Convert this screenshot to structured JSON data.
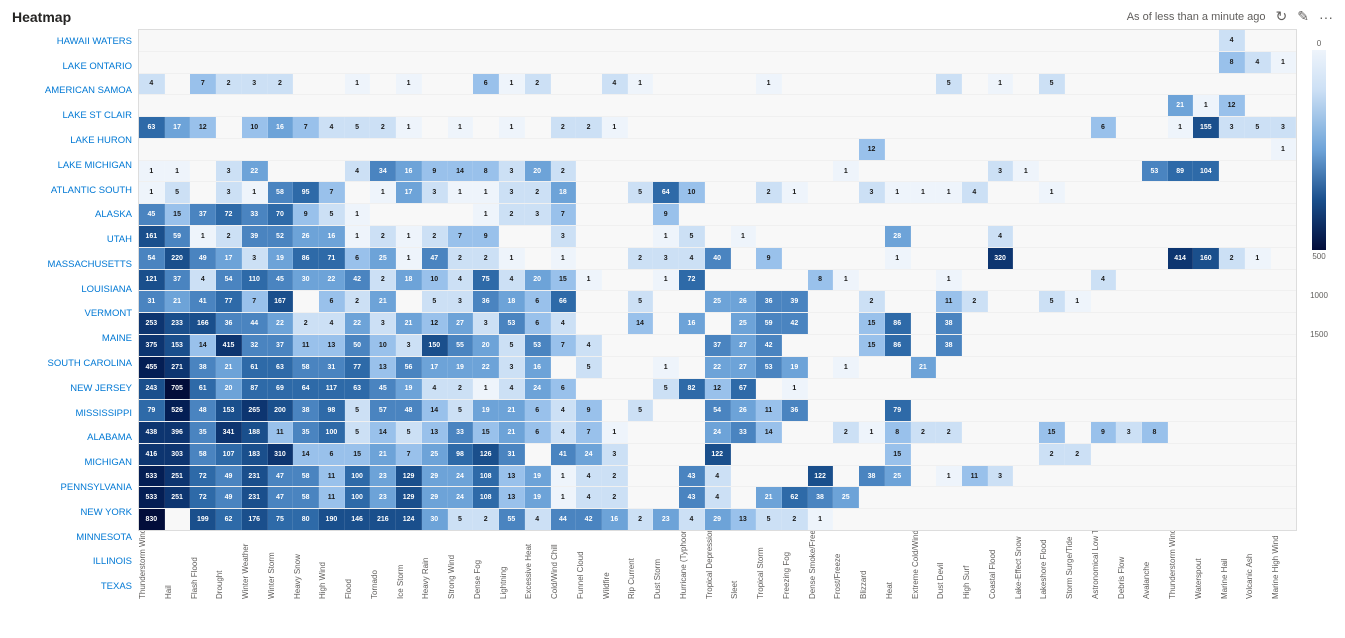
{
  "header": {
    "title": "Heatmap",
    "timestamp": "As of less than a minute ago",
    "refresh_icon": "↻",
    "edit_icon": "✎",
    "more_icon": "···"
  },
  "legend": {
    "values": [
      "0",
      "",
      "500",
      "",
      "1000",
      "",
      "1500"
    ]
  },
  "y_labels": [
    "HAWAII WATERS",
    "LAKE ONTARIO",
    "AMERICAN SAMOA",
    "LAKE ST CLAIR",
    "LAKE HURON",
    "LAKE MICHIGAN",
    "ATLANTIC SOUTH",
    "ALASKA",
    "UTAH",
    "MASSACHUSETTS",
    "LOUISIANA",
    "VERMONT",
    "MAINE",
    "SOUTH CAROLINA",
    "NEW JERSEY",
    "MISSISSIPPI",
    "ALABAMA",
    "MICHIGAN",
    "PENNSYLVANIA",
    "NEW YORK",
    "MINNESOTA",
    "ILLINOIS",
    "TEXAS"
  ],
  "x_labels": [
    "Thunderstorm Wind",
    "Hail",
    "Flash Flood",
    "Drought",
    "Winter Weather",
    "Winter Storm",
    "Heavy Snow",
    "High Wind",
    "Flood",
    "Tornado",
    "Ice Storm",
    "Heavy Rain",
    "Strong Wind",
    "Dense Fog",
    "Lightning",
    "Excessive Heat",
    "Cold/Wind Chill",
    "Funnel Cloud",
    "Wildfire",
    "Rip Current",
    "Dust Storm",
    "Hurricane (Typhoon)",
    "Tropical Depression",
    "Sleet",
    "Tropical Storm",
    "Freezing Fog",
    "Dense Smoke/Freeze",
    "Frost/Freeze",
    "Blizzard",
    "Heat",
    "Extreme Cold/Wind Chill",
    "Dust Devil",
    "High Surf",
    "Coastal Flood",
    "Lake-Effect Snow",
    "Lakeshore Flood",
    "Storm Surge/Tide",
    "Astronomical Low Tide",
    "Debris Flow",
    "Avalanche",
    "Thunderstorm Wind",
    "Waterspout",
    "Marine Hail",
    "Volcanic Ash",
    "Marine High Wind"
  ],
  "rows": [
    {
      "label": "HAWAII WATERS",
      "cells": [
        0,
        0,
        0,
        0,
        0,
        0,
        0,
        0,
        0,
        0,
        0,
        0,
        0,
        0,
        0,
        0,
        0,
        0,
        0,
        0,
        0,
        0,
        0,
        0,
        0,
        0,
        0,
        0,
        0,
        0,
        0,
        0,
        0,
        0,
        0,
        0,
        0,
        0,
        0,
        0,
        0,
        0,
        4,
        0,
        0
      ]
    },
    {
      "label": "LAKE ONTARIO",
      "cells": [
        0,
        0,
        0,
        0,
        0,
        0,
        0,
        0,
        0,
        0,
        0,
        0,
        0,
        0,
        0,
        0,
        0,
        0,
        0,
        0,
        0,
        0,
        0,
        0,
        0,
        0,
        0,
        0,
        0,
        0,
        0,
        0,
        0,
        0,
        0,
        0,
        0,
        0,
        0,
        0,
        0,
        0,
        8,
        4,
        1
      ]
    },
    {
      "label": "AMERICAN SAMOA",
      "cells": [
        4,
        0,
        7,
        2,
        3,
        2,
        0,
        0,
        1,
        0,
        1,
        0,
        0,
        6,
        1,
        2,
        0,
        0,
        4,
        1,
        0,
        0,
        0,
        0,
        1,
        0,
        0,
        0,
        0,
        0,
        0,
        5,
        0,
        1,
        0,
        5,
        0,
        0,
        0,
        0,
        0,
        0,
        0,
        0,
        0
      ]
    },
    {
      "label": "LAKE ST CLAIR",
      "cells": [
        0,
        0,
        0,
        0,
        0,
        0,
        0,
        0,
        0,
        0,
        0,
        0,
        0,
        0,
        0,
        0,
        0,
        0,
        0,
        0,
        0,
        0,
        0,
        0,
        0,
        0,
        0,
        0,
        0,
        0,
        0,
        0,
        0,
        0,
        0,
        0,
        0,
        0,
        0,
        0,
        21,
        1,
        12,
        0,
        0
      ]
    },
    {
      "label": "LAKE HURON",
      "cells": [
        63,
        17,
        12,
        0,
        10,
        16,
        7,
        4,
        5,
        2,
        1,
        0,
        1,
        0,
        1,
        0,
        2,
        2,
        1,
        0,
        0,
        0,
        0,
        0,
        0,
        0,
        0,
        0,
        0,
        0,
        0,
        0,
        0,
        0,
        0,
        0,
        0,
        6,
        0,
        0,
        1,
        155,
        3,
        5,
        3
      ]
    },
    {
      "label": "LAKE MICHIGAN",
      "cells": [
        0,
        0,
        0,
        0,
        0,
        0,
        0,
        0,
        0,
        0,
        0,
        0,
        0,
        0,
        0,
        0,
        0,
        0,
        0,
        0,
        0,
        0,
        0,
        0,
        0,
        0,
        0,
        0,
        12,
        0,
        0,
        0,
        0,
        0,
        0,
        0,
        0,
        0,
        0,
        0,
        0,
        0,
        0,
        0,
        1
      ]
    },
    {
      "label": "ATLANTIC SOUTH",
      "cells": [
        1,
        1,
        0,
        3,
        22,
        0,
        0,
        0,
        4,
        34,
        16,
        9,
        14,
        8,
        3,
        20,
        2,
        0,
        0,
        0,
        0,
        0,
        0,
        0,
        0,
        0,
        0,
        1,
        0,
        0,
        0,
        0,
        0,
        3,
        1,
        0,
        0,
        0,
        0,
        53,
        89,
        104,
        0,
        0,
        0
      ]
    },
    {
      "label": "ALASKA",
      "cells": [
        1,
        5,
        0,
        3,
        1,
        58,
        95,
        7,
        0,
        1,
        17,
        3,
        1,
        1,
        3,
        2,
        18,
        0,
        0,
        5,
        64,
        10,
        0,
        0,
        2,
        1,
        0,
        0,
        3,
        1,
        1,
        1,
        4,
        0,
        0,
        1,
        0,
        0,
        0,
        0,
        0,
        0,
        0,
        0,
        0
      ]
    },
    {
      "label": "UTAH",
      "cells": [
        45,
        15,
        37,
        72,
        33,
        70,
        9,
        5,
        1,
        0,
        0,
        0,
        0,
        1,
        2,
        3,
        7,
        0,
        0,
        0,
        9,
        0,
        0,
        0,
        0,
        0,
        0,
        0,
        0,
        0,
        0,
        0,
        0,
        0,
        0,
        0,
        0,
        0,
        0,
        0,
        0,
        0,
        0,
        0,
        0
      ]
    },
    {
      "label": "MASSACHUSETTS",
      "cells": [
        161,
        59,
        1,
        2,
        39,
        52,
        26,
        16,
        1,
        2,
        1,
        2,
        7,
        9,
        0,
        0,
        3,
        0,
        0,
        0,
        1,
        5,
        0,
        1,
        0,
        0,
        0,
        0,
        0,
        28,
        0,
        0,
        0,
        4,
        0,
        0,
        0,
        0,
        0,
        0,
        0,
        0,
        0,
        0,
        0
      ]
    },
    {
      "label": "LOUISIANA",
      "cells": [
        54,
        220,
        49,
        17,
        3,
        19,
        86,
        71,
        6,
        25,
        1,
        47,
        2,
        2,
        1,
        0,
        1,
        0,
        0,
        2,
        3,
        4,
        40,
        0,
        9,
        0,
        0,
        0,
        0,
        1,
        0,
        0,
        0,
        320,
        0,
        0,
        0,
        0,
        0,
        0,
        414,
        160,
        2,
        1,
        0
      ]
    },
    {
      "label": "VERMONT",
      "cells": [
        121,
        37,
        4,
        54,
        110,
        45,
        30,
        22,
        42,
        2,
        18,
        10,
        4,
        75,
        4,
        20,
        15,
        1,
        0,
        0,
        1,
        72,
        0,
        0,
        0,
        0,
        8,
        1,
        0,
        0,
        0,
        1,
        0,
        0,
        0,
        0,
        0,
        4,
        0,
        0,
        0,
        0,
        0,
        0,
        0
      ]
    },
    {
      "label": "MAINE",
      "cells": [
        31,
        21,
        41,
        77,
        7,
        167,
        0,
        6,
        2,
        21,
        0,
        5,
        3,
        36,
        18,
        6,
        66,
        0,
        0,
        5,
        0,
        0,
        25,
        26,
        36,
        39,
        0,
        0,
        2,
        0,
        0,
        11,
        2,
        0,
        0,
        5,
        1,
        0,
        0,
        0,
        0,
        0,
        0,
        0,
        0
      ]
    },
    {
      "label": "SOUTH CAROLINA",
      "cells": [
        253,
        233,
        166,
        36,
        44,
        22,
        2,
        4,
        22,
        3,
        21,
        12,
        27,
        3,
        53,
        6,
        4,
        0,
        0,
        14,
        0,
        16,
        0,
        25,
        59,
        42,
        0,
        0,
        15,
        86,
        0,
        38,
        0,
        0,
        0,
        0,
        0,
        0,
        0,
        0,
        0,
        0,
        0,
        0,
        0
      ]
    },
    {
      "label": "NEW JERSEY",
      "cells": [
        375,
        153,
        14,
        415,
        32,
        37,
        11,
        13,
        50,
        10,
        3,
        150,
        55,
        20,
        5,
        53,
        7,
        4,
        0,
        0,
        0,
        0,
        37,
        27,
        42,
        0,
        0,
        0,
        15,
        86,
        0,
        38,
        0,
        0,
        0,
        0,
        0,
        0,
        0,
        0,
        0,
        0,
        0,
        0,
        0
      ]
    },
    {
      "label": "MISSISSIPPI",
      "cells": [
        455,
        271,
        38,
        21,
        61,
        63,
        58,
        31,
        77,
        13,
        56,
        17,
        19,
        22,
        3,
        16,
        0,
        5,
        0,
        0,
        1,
        0,
        22,
        27,
        53,
        19,
        0,
        1,
        0,
        0,
        21,
        0,
        0,
        0,
        0,
        0,
        0,
        0,
        0,
        0,
        0,
        0,
        0,
        0,
        0
      ]
    },
    {
      "label": "ALABAMA",
      "cells": [
        243,
        705,
        61,
        20,
        87,
        69,
        64,
        117,
        63,
        45,
        19,
        4,
        2,
        1,
        4,
        24,
        6,
        0,
        0,
        0,
        5,
        82,
        12,
        67,
        0,
        1,
        0,
        0,
        0,
        0,
        0,
        0,
        0,
        0,
        0,
        0,
        0,
        0,
        0,
        0,
        0,
        0,
        0,
        0,
        0
      ]
    },
    {
      "label": "MICHIGAN",
      "cells": [
        79,
        526,
        48,
        153,
        265,
        200,
        38,
        98,
        5,
        57,
        48,
        14,
        5,
        19,
        21,
        6,
        4,
        9,
        0,
        5,
        0,
        0,
        54,
        26,
        11,
        36,
        0,
        0,
        0,
        79,
        0,
        0,
        0,
        0,
        0,
        0,
        0,
        0,
        0,
        0,
        0,
        0,
        0,
        0,
        0
      ]
    },
    {
      "label": "PENNSYLVANIA",
      "cells": [
        438,
        396,
        35,
        341,
        188,
        11,
        35,
        100,
        5,
        14,
        5,
        13,
        33,
        15,
        21,
        6,
        4,
        7,
        1,
        0,
        0,
        0,
        24,
        33,
        14,
        0,
        0,
        2,
        1,
        8,
        2,
        2,
        0,
        0,
        0,
        15,
        0,
        9,
        3,
        8,
        0,
        0,
        0,
        0,
        0
      ]
    },
    {
      "label": "NEW YORK",
      "cells": [
        416,
        303,
        58,
        107,
        183,
        310,
        14,
        6,
        15,
        21,
        7,
        25,
        98,
        126,
        31,
        0,
        41,
        24,
        3,
        0,
        0,
        0,
        122,
        0,
        0,
        0,
        0,
        0,
        0,
        15,
        0,
        0,
        0,
        0,
        0,
        2,
        2,
        0,
        0,
        0,
        0,
        0,
        0,
        0,
        0
      ]
    },
    {
      "label": "MINNESOTA",
      "cells": [
        533,
        251,
        72,
        49,
        231,
        47,
        58,
        11,
        100,
        23,
        129,
        29,
        24,
        108,
        13,
        19,
        1,
        4,
        2,
        0,
        0,
        43,
        4,
        0,
        0,
        0,
        122,
        0,
        38,
        25,
        0,
        1,
        11,
        3,
        0,
        0,
        0,
        0,
        0,
        0,
        0,
        0,
        0,
        0,
        0
      ]
    },
    {
      "label": "ILLINOIS",
      "cells": [
        533,
        251,
        72,
        49,
        231,
        47,
        58,
        11,
        100,
        23,
        129,
        29,
        24,
        108,
        13,
        19,
        1,
        4,
        2,
        0,
        0,
        43,
        4,
        0,
        21,
        62,
        38,
        25,
        0,
        0,
        0,
        0,
        0,
        0,
        0,
        0,
        0,
        0,
        0,
        0,
        0,
        0,
        0,
        0,
        0
      ]
    },
    {
      "label": "TEXAS",
      "cells": [
        830,
        0,
        199,
        62,
        176,
        75,
        80,
        190,
        146,
        216,
        124,
        30,
        5,
        2,
        55,
        4,
        44,
        42,
        16,
        2,
        23,
        4,
        29,
        13,
        5,
        2,
        1,
        0,
        0,
        0,
        0,
        0,
        0,
        0,
        0,
        0,
        0,
        0,
        0,
        0,
        0,
        0,
        0,
        0,
        0
      ]
    }
  ]
}
